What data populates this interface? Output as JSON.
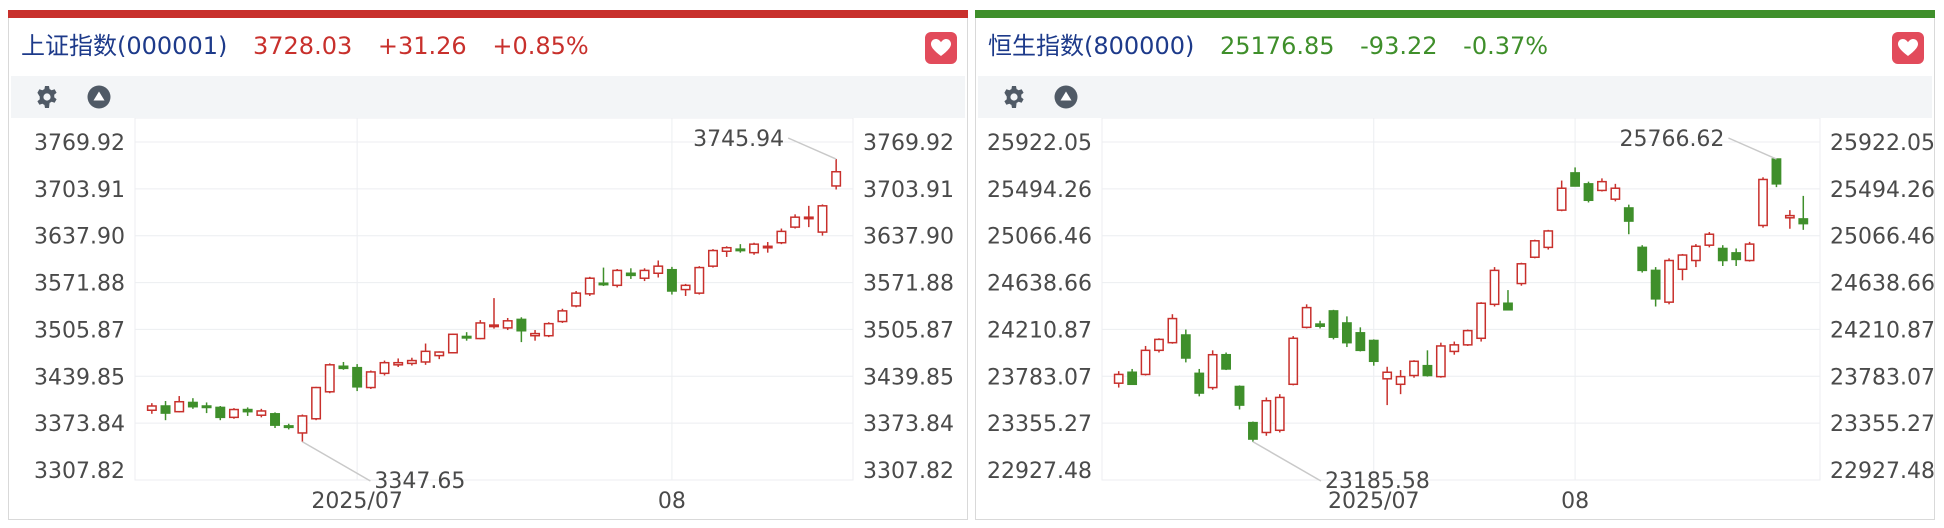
{
  "colors": {
    "up": "#c8302c",
    "down": "#3f8f2b",
    "fav": "#e24b5b",
    "title": "#1d3a8a",
    "toolbar_icon": "#505a66"
  },
  "icons": {
    "settings": "gear-icon",
    "collapse": "triangle-up-circle-icon",
    "favorite": "heart-icon"
  },
  "panels": [
    {
      "title": "上证指数(000001)",
      "price": "3728.03",
      "change": "+31.26",
      "pct": "+0.85%",
      "trend": "up",
      "y_labels": [
        "3769.92",
        "3703.91",
        "3637.90",
        "3571.88",
        "3505.87",
        "3439.85",
        "3373.84",
        "3307.82"
      ],
      "x_labels": [
        "2025/07",
        "08"
      ],
      "annotations": {
        "high": "3745.94",
        "low": "3347.65"
      }
    },
    {
      "title": "恒生指数(800000)",
      "price": "25176.85",
      "change": "-93.22",
      "pct": "-0.37%",
      "trend": "down",
      "y_labels": [
        "25922.05",
        "25494.26",
        "25066.46",
        "24638.66",
        "24210.87",
        "23783.07",
        "23355.27",
        "22927.48"
      ],
      "x_labels": [
        "2025/07",
        "08"
      ],
      "annotations": {
        "high": "25766.62",
        "low": "23185.58"
      }
    }
  ],
  "chart_data": [
    {
      "type": "candlestick",
      "title": "上证指数(000001)",
      "ylim": [
        3307.82,
        3769.92
      ],
      "ticks_y": [
        3769.92,
        3703.91,
        3637.9,
        3571.88,
        3505.87,
        3439.85,
        3373.84,
        3307.82
      ],
      "x_ticks": [
        {
          "label": "2025/07",
          "index": 15
        },
        {
          "label": "08",
          "index": 38
        }
      ],
      "series": [
        {
          "o": 3392,
          "h": 3402,
          "l": 3387,
          "c": 3398
        },
        {
          "o": 3398,
          "h": 3405,
          "l": 3378,
          "c": 3388
        },
        {
          "o": 3390,
          "h": 3412,
          "l": 3389,
          "c": 3404
        },
        {
          "o": 3403,
          "h": 3409,
          "l": 3394,
          "c": 3397
        },
        {
          "o": 3398,
          "h": 3403,
          "l": 3388,
          "c": 3397
        },
        {
          "o": 3396,
          "h": 3398,
          "l": 3378,
          "c": 3382
        },
        {
          "o": 3382,
          "h": 3395,
          "l": 3380,
          "c": 3393
        },
        {
          "o": 3393,
          "h": 3396,
          "l": 3384,
          "c": 3390
        },
        {
          "o": 3385,
          "h": 3394,
          "l": 3382,
          "c": 3391
        },
        {
          "o": 3387,
          "h": 3389,
          "l": 3367,
          "c": 3371
        },
        {
          "o": 3370,
          "h": 3373,
          "l": 3365,
          "c": 3368
        },
        {
          "o": 3360,
          "h": 3386,
          "l": 3347.65,
          "c": 3384
        },
        {
          "o": 3380,
          "h": 3425,
          "l": 3378,
          "c": 3424
        },
        {
          "o": 3418,
          "h": 3458,
          "l": 3416,
          "c": 3456
        },
        {
          "o": 3454,
          "h": 3460,
          "l": 3449,
          "c": 3451
        },
        {
          "o": 3452,
          "h": 3457,
          "l": 3419,
          "c": 3425
        },
        {
          "o": 3424,
          "h": 3448,
          "l": 3422,
          "c": 3446
        },
        {
          "o": 3444,
          "h": 3462,
          "l": 3441,
          "c": 3459
        },
        {
          "o": 3456,
          "h": 3465,
          "l": 3453,
          "c": 3459
        },
        {
          "o": 3458,
          "h": 3466,
          "l": 3455,
          "c": 3462
        },
        {
          "o": 3460,
          "h": 3486,
          "l": 3456,
          "c": 3475
        },
        {
          "o": 3469,
          "h": 3475,
          "l": 3464,
          "c": 3474
        },
        {
          "o": 3473,
          "h": 3500,
          "l": 3472,
          "c": 3499
        },
        {
          "o": 3496,
          "h": 3502,
          "l": 3490,
          "c": 3494
        },
        {
          "o": 3493,
          "h": 3519,
          "l": 3492,
          "c": 3515
        },
        {
          "o": 3510,
          "h": 3550,
          "l": 3507,
          "c": 3512
        },
        {
          "o": 3508,
          "h": 3522,
          "l": 3505,
          "c": 3518
        },
        {
          "o": 3520,
          "h": 3523,
          "l": 3488,
          "c": 3504
        },
        {
          "o": 3497,
          "h": 3505,
          "l": 3490,
          "c": 3500
        },
        {
          "o": 3497,
          "h": 3516,
          "l": 3495,
          "c": 3514
        },
        {
          "o": 3517,
          "h": 3535,
          "l": 3515,
          "c": 3532
        },
        {
          "o": 3539,
          "h": 3560,
          "l": 3537,
          "c": 3557
        },
        {
          "o": 3556,
          "h": 3580,
          "l": 3553,
          "c": 3578
        },
        {
          "o": 3571,
          "h": 3593,
          "l": 3567,
          "c": 3569
        },
        {
          "o": 3568,
          "h": 3591,
          "l": 3565,
          "c": 3589
        },
        {
          "o": 3585,
          "h": 3592,
          "l": 3577,
          "c": 3582
        },
        {
          "o": 3578,
          "h": 3592,
          "l": 3574,
          "c": 3589
        },
        {
          "o": 3585,
          "h": 3603,
          "l": 3579,
          "c": 3595
        },
        {
          "o": 3590,
          "h": 3594,
          "l": 3555,
          "c": 3560
        },
        {
          "o": 3562,
          "h": 3570,
          "l": 3553,
          "c": 3568
        },
        {
          "o": 3557,
          "h": 3595,
          "l": 3555,
          "c": 3593
        },
        {
          "o": 3595,
          "h": 3619,
          "l": 3593,
          "c": 3617
        },
        {
          "o": 3616,
          "h": 3623,
          "l": 3608,
          "c": 3621
        },
        {
          "o": 3619,
          "h": 3626,
          "l": 3614,
          "c": 3618
        },
        {
          "o": 3614,
          "h": 3628,
          "l": 3611,
          "c": 3626
        },
        {
          "o": 3622,
          "h": 3629,
          "l": 3614,
          "c": 3623
        },
        {
          "o": 3628,
          "h": 3648,
          "l": 3626,
          "c": 3644
        },
        {
          "o": 3650,
          "h": 3668,
          "l": 3648,
          "c": 3664
        },
        {
          "o": 3664,
          "h": 3680,
          "l": 3650,
          "c": 3664
        },
        {
          "o": 3643,
          "h": 3682,
          "l": 3638,
          "c": 3680
        },
        {
          "o": 3708,
          "h": 3745.94,
          "l": 3703,
          "c": 3728.03
        }
      ]
    },
    {
      "type": "candlestick",
      "title": "恒生指数(800000)",
      "ylim": [
        22927.48,
        25922.05
      ],
      "ticks_y": [
        25922.05,
        25494.26,
        25066.46,
        24638.66,
        24210.87,
        23783.07,
        23355.27,
        22927.48
      ],
      "x_ticks": [
        {
          "label": "2025/07",
          "index": 19
        },
        {
          "label": "08",
          "index": 34
        }
      ],
      "series": [
        {
          "o": 23720,
          "h": 23830,
          "l": 23680,
          "c": 23800
        },
        {
          "o": 23820,
          "h": 23850,
          "l": 23720,
          "c": 23710
        },
        {
          "o": 23800,
          "h": 24060,
          "l": 23790,
          "c": 24020
        },
        {
          "o": 24020,
          "h": 24130,
          "l": 24000,
          "c": 24120
        },
        {
          "o": 24090,
          "h": 24350,
          "l": 24080,
          "c": 24310
        },
        {
          "o": 24160,
          "h": 24210,
          "l": 23910,
          "c": 23950
        },
        {
          "o": 23810,
          "h": 23850,
          "l": 23600,
          "c": 23630
        },
        {
          "o": 23680,
          "h": 24020,
          "l": 23660,
          "c": 23980
        },
        {
          "o": 23980,
          "h": 24000,
          "l": 23840,
          "c": 23850
        },
        {
          "o": 23690,
          "h": 23700,
          "l": 23480,
          "c": 23520
        },
        {
          "o": 23360,
          "h": 23370,
          "l": 23185.58,
          "c": 23210
        },
        {
          "o": 23270,
          "h": 23590,
          "l": 23240,
          "c": 23560
        },
        {
          "o": 23290,
          "h": 23620,
          "l": 23270,
          "c": 23590
        },
        {
          "o": 23710,
          "h": 24150,
          "l": 23700,
          "c": 24130
        },
        {
          "o": 24230,
          "h": 24440,
          "l": 24220,
          "c": 24410
        },
        {
          "o": 24260,
          "h": 24290,
          "l": 24220,
          "c": 24240
        },
        {
          "o": 24380,
          "h": 24390,
          "l": 24120,
          "c": 24140
        },
        {
          "o": 24270,
          "h": 24330,
          "l": 24050,
          "c": 24090
        },
        {
          "o": 24180,
          "h": 24230,
          "l": 24010,
          "c": 24020
        },
        {
          "o": 24110,
          "h": 24120,
          "l": 23880,
          "c": 23920
        },
        {
          "o": 23760,
          "h": 23870,
          "l": 23520,
          "c": 23820
        },
        {
          "o": 23710,
          "h": 23840,
          "l": 23620,
          "c": 23780
        },
        {
          "o": 23790,
          "h": 23930,
          "l": 23770,
          "c": 23920
        },
        {
          "o": 23880,
          "h": 24020,
          "l": 23780,
          "c": 23790
        },
        {
          "o": 23780,
          "h": 24090,
          "l": 23770,
          "c": 24060
        },
        {
          "o": 24010,
          "h": 24100,
          "l": 23980,
          "c": 24070
        },
        {
          "o": 24070,
          "h": 24210,
          "l": 24060,
          "c": 24200
        },
        {
          "o": 24130,
          "h": 24460,
          "l": 24100,
          "c": 24450
        },
        {
          "o": 24440,
          "h": 24780,
          "l": 24420,
          "c": 24750
        },
        {
          "o": 24450,
          "h": 24570,
          "l": 24400,
          "c": 24390
        },
        {
          "o": 24630,
          "h": 24820,
          "l": 24610,
          "c": 24810
        },
        {
          "o": 24870,
          "h": 25030,
          "l": 24860,
          "c": 25020
        },
        {
          "o": 24960,
          "h": 25120,
          "l": 24940,
          "c": 25110
        },
        {
          "o": 25300,
          "h": 25570,
          "l": 25290,
          "c": 25500
        },
        {
          "o": 25640,
          "h": 25690,
          "l": 25520,
          "c": 25520
        },
        {
          "o": 25540,
          "h": 25560,
          "l": 25370,
          "c": 25390
        },
        {
          "o": 25480,
          "h": 25590,
          "l": 25470,
          "c": 25560
        },
        {
          "o": 25400,
          "h": 25540,
          "l": 25380,
          "c": 25500
        },
        {
          "o": 25320,
          "h": 25350,
          "l": 25080,
          "c": 25200
        },
        {
          "o": 24960,
          "h": 24980,
          "l": 24730,
          "c": 24750
        },
        {
          "o": 24750,
          "h": 24780,
          "l": 24420,
          "c": 24490
        },
        {
          "o": 24460,
          "h": 24860,
          "l": 24440,
          "c": 24840
        },
        {
          "o": 24760,
          "h": 24900,
          "l": 24660,
          "c": 24890
        },
        {
          "o": 24840,
          "h": 24990,
          "l": 24780,
          "c": 24970
        },
        {
          "o": 24980,
          "h": 25100,
          "l": 24960,
          "c": 25080
        },
        {
          "o": 24950,
          "h": 24980,
          "l": 24790,
          "c": 24840
        },
        {
          "o": 24910,
          "h": 24950,
          "l": 24790,
          "c": 24850
        },
        {
          "o": 24840,
          "h": 25010,
          "l": 24830,
          "c": 24990
        },
        {
          "o": 25160,
          "h": 25600,
          "l": 25140,
          "c": 25580
        },
        {
          "o": 25766.62,
          "h": 25766.62,
          "l": 25510,
          "c": 25540
        },
        {
          "o": 25230,
          "h": 25300,
          "l": 25130,
          "c": 25250
        },
        {
          "o": 25220,
          "h": 25430,
          "l": 25120,
          "c": 25176.85
        }
      ]
    }
  ]
}
